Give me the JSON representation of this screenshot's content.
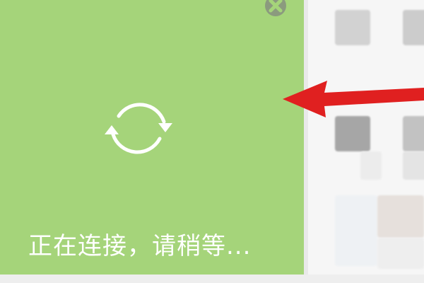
{
  "panel": {
    "status_text": "正在连接，请稍等...",
    "background_color": "#a5d47a",
    "refresh_icon": "refresh-icon",
    "close_icon": "close-icon"
  },
  "annotation": {
    "arrow_icon": "red-arrow-left-icon",
    "arrow_color": "#e02020"
  }
}
